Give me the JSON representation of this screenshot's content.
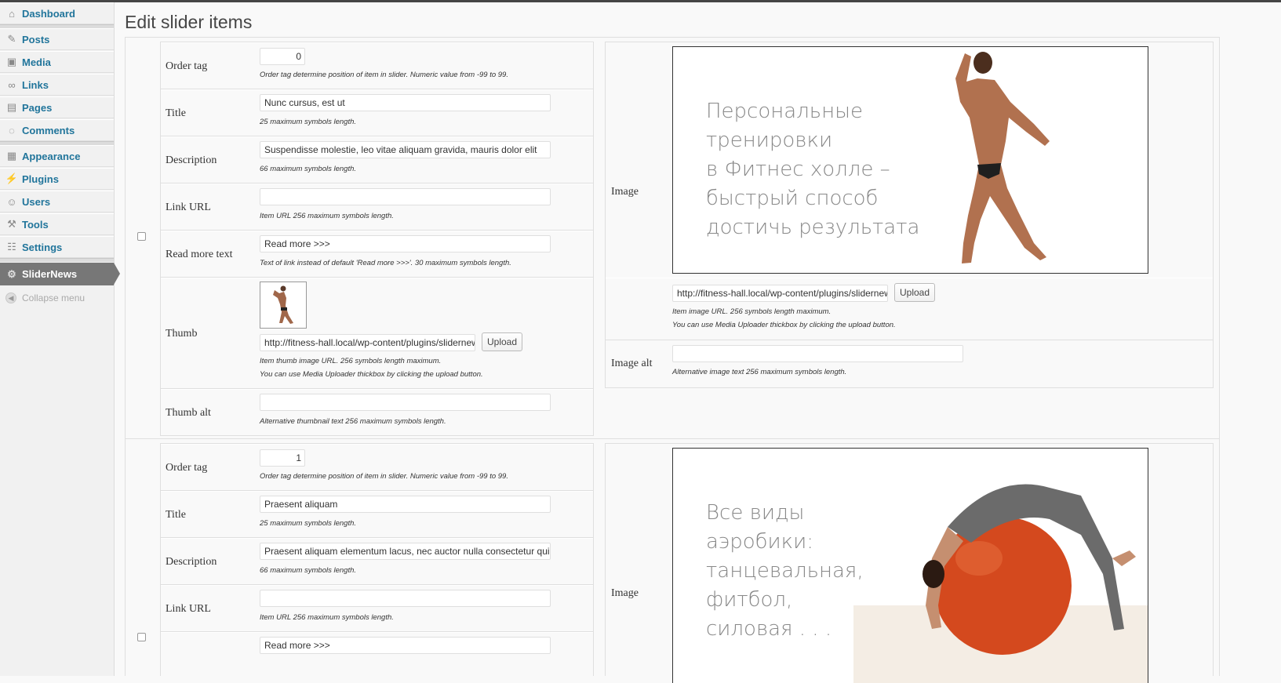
{
  "sidebar": {
    "items": [
      {
        "label": "Dashboard",
        "icon": "home-icon"
      },
      {
        "label": "Posts",
        "icon": "pin-icon"
      },
      {
        "label": "Media",
        "icon": "media-icon"
      },
      {
        "label": "Links",
        "icon": "link-icon"
      },
      {
        "label": "Pages",
        "icon": "pages-icon"
      },
      {
        "label": "Comments",
        "icon": "comment-icon"
      },
      {
        "label": "Appearance",
        "icon": "appearance-icon"
      },
      {
        "label": "Plugins",
        "icon": "plugin-icon"
      },
      {
        "label": "Users",
        "icon": "users-icon"
      },
      {
        "label": "Tools",
        "icon": "tools-icon"
      },
      {
        "label": "Settings",
        "icon": "settings-icon"
      }
    ],
    "active": {
      "label": "SliderNews",
      "icon": "gear-icon"
    },
    "collapse_label": "Collapse menu"
  },
  "page_title": "Edit slider items",
  "labels": {
    "order_tag": "Order tag",
    "title": "Title",
    "description": "Description",
    "link_url": "Link URL",
    "read_more_text": "Read more text",
    "thumb": "Thumb",
    "thumb_alt": "Thumb alt",
    "image": "Image",
    "image_alt": "Image alt"
  },
  "hints": {
    "order_tag": "Order tag determine position of item in slider. Numeric value from -99 to 99.",
    "title": "25 maximum symbols length.",
    "description": "66 maximum symbols length.",
    "link_url": "Item URL 256 maximum symbols length.",
    "read_more": "Text of link instead of default 'Read more >>>'. 30 maximum symbols length.",
    "thumb_url": "Item thumb image URL. 256 symbols length maximum.",
    "uploader": "You can use Media Uploader thickbox by clicking the upload button.",
    "thumb_alt": "Alternative thumbnail text 256 maximum symbols length.",
    "image_url": "Item image URL. 256 symbols length maximum.",
    "image_alt": "Alternative image text 256 maximum symbols length."
  },
  "upload_label": "Upload",
  "items": [
    {
      "order_tag": "0",
      "title": "Nunc cursus, est ut",
      "description": "Suspendisse molestie, leo vitae aliquam gravida, mauris dolor elit",
      "link_url": "",
      "read_more": "Read more >>>",
      "thumb_url": "http://fitness-hall.local/wp-content/plugins/slidernews",
      "thumb_alt": "",
      "image_url": "http://fitness-hall.local/wp-content/plugins/slidernews",
      "image_alt": "",
      "slide_lines": [
        "Персональные",
        "тренировки",
        "в Фитнес холле –",
        "быстрый способ",
        "достичь результата"
      ]
    },
    {
      "order_tag": "1",
      "title": "Praesent aliquam",
      "description": "Praesent aliquam elementum lacus, nec auctor nulla consectetur qui",
      "link_url": "",
      "read_more": "Read more >>>",
      "slide_lines": [
        "Все виды",
        "аэробики:",
        "танцевальная,",
        "фитбол,",
        "силовая . . ."
      ]
    }
  ]
}
